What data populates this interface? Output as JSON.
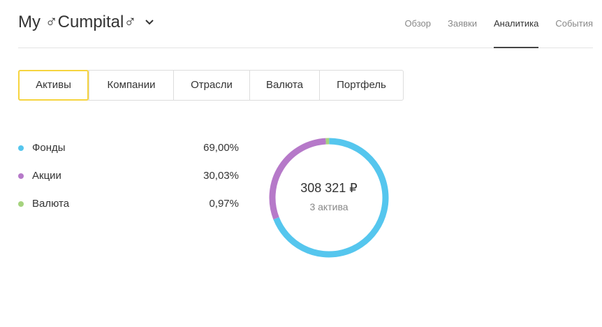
{
  "header": {
    "title": "My ♂Cumpital♂",
    "nav": [
      {
        "label": "Обзор",
        "active": false
      },
      {
        "label": "Заявки",
        "active": false
      },
      {
        "label": "Аналитика",
        "active": true
      },
      {
        "label": "События",
        "active": false
      }
    ]
  },
  "tabs": [
    {
      "label": "Активы",
      "active": true
    },
    {
      "label": "Компании",
      "active": false
    },
    {
      "label": "Отрасли",
      "active": false
    },
    {
      "label": "Валюта",
      "active": false
    },
    {
      "label": "Портфель",
      "active": false
    }
  ],
  "allocation": {
    "items": [
      {
        "label": "Фонды",
        "percent": "69,00%",
        "value": 69.0,
        "color": "#55c6ee"
      },
      {
        "label": "Акции",
        "percent": "30,03%",
        "value": 30.03,
        "color": "#b679c9"
      },
      {
        "label": "Валюта",
        "percent": "0,97%",
        "value": 0.97,
        "color": "#a5d37e"
      }
    ],
    "total": "308 321 ₽",
    "count_label": "3 актива"
  },
  "colors": {
    "accent_border": "#f6d43f",
    "active_nav_underline": "#444444"
  },
  "icons": {
    "title_dropdown": "chevron-down-icon"
  }
}
